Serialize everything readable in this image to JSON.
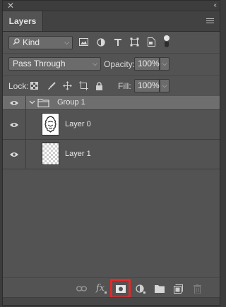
{
  "window": {
    "close_glyph": "✕",
    "collapse_glyph": "‹‹"
  },
  "tabs": [
    {
      "label": "Layers",
      "active": true
    }
  ],
  "filter": {
    "kind_label": "Kind",
    "icons": [
      "image-filter-icon",
      "adjustment-filter-icon",
      "type-filter-icon",
      "shape-filter-icon",
      "smart-object-filter-icon"
    ],
    "filter_toggle": "on"
  },
  "blend": {
    "mode": "Pass Through",
    "opacity_label": "Opacity:",
    "opacity_value": "100%"
  },
  "locks": {
    "label": "Lock:",
    "icons": [
      "lock-transparent-pixels-icon",
      "lock-image-pixels-icon",
      "lock-position-icon",
      "lock-artboard-icon",
      "lock-all-icon"
    ],
    "fill_label": "Fill:",
    "fill_value": "100%"
  },
  "layers": [
    {
      "name": "Group 1",
      "type": "group",
      "visible": true,
      "expanded": true,
      "selected": true
    },
    {
      "name": "Layer 0",
      "type": "layer",
      "visible": true,
      "thumb": "figure"
    },
    {
      "name": "Layer 1",
      "type": "layer",
      "visible": true,
      "thumb": "transparent"
    }
  ],
  "bottom_bar": {
    "icons": [
      "link-layers-icon",
      "fx-icon",
      "add-mask-icon",
      "new-adjustment-layer-icon",
      "new-group-icon",
      "new-layer-icon",
      "delete-layer-icon"
    ],
    "fx_label": "fx",
    "highlighted": "add-mask-icon",
    "highlight_color": "#e02a2a"
  },
  "colors": {
    "panel_bg": "#535353",
    "selected_row": "#6e6e6e",
    "field_bg": "#6b6b6b"
  }
}
